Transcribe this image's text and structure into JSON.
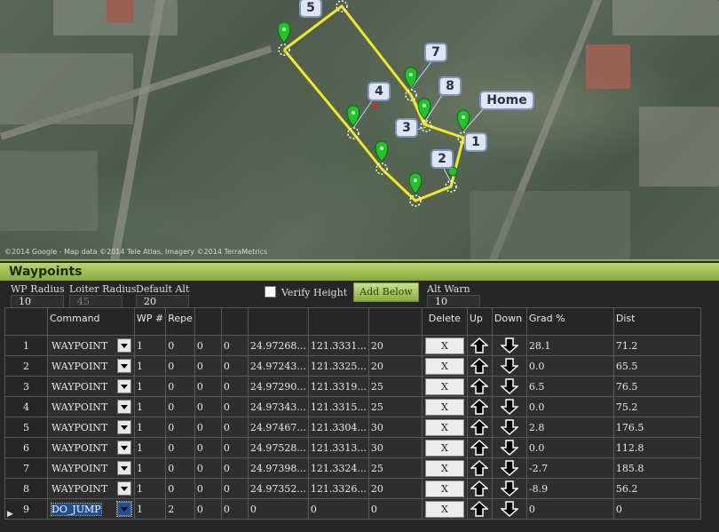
{
  "map": {
    "copyright": "©2014 Google - Map data ©2014 Tele Atlas, Imagery ©2014 TerraMetrics",
    "labels": [
      "5",
      "7",
      "4",
      "8",
      "Home",
      "3",
      "1",
      "2"
    ]
  },
  "panel": {
    "title": "Waypoints",
    "wp_radius_label": "WP Radius",
    "wp_radius_value": "10",
    "loiter_radius_label": "Loiter Radius",
    "loiter_radius_value": "45",
    "default_alt_label": "Default Alt",
    "default_alt_value": "20",
    "verify_height_label": "Verify Height",
    "add_below_label": "Add Below",
    "alt_warn_label": "Alt Warn",
    "alt_warn_value": "10"
  },
  "grid": {
    "headers": [
      "Command",
      "WP #",
      "Repe",
      "",
      "",
      "",
      "",
      "",
      "Delete",
      "Up",
      "Down",
      "Grad %",
      "Dist"
    ],
    "rows": [
      {
        "n": "1",
        "cmd": "WAYPOINT",
        "wp": "1",
        "p2": "0",
        "p3": "0",
        "p4": "0",
        "lat": "24.97268...",
        "lng": "121.3331...",
        "alt": "20",
        "del": "X",
        "grad": "28.1",
        "dist": "71.2"
      },
      {
        "n": "2",
        "cmd": "WAYPOINT",
        "wp": "1",
        "p2": "0",
        "p3": "0",
        "p4": "0",
        "lat": "24.97243...",
        "lng": "121.3325...",
        "alt": "20",
        "del": "X",
        "grad": "0.0",
        "dist": "65.5"
      },
      {
        "n": "3",
        "cmd": "WAYPOINT",
        "wp": "1",
        "p2": "0",
        "p3": "0",
        "p4": "0",
        "lat": "24.97290...",
        "lng": "121.3319...",
        "alt": "25",
        "del": "X",
        "grad": "6.5",
        "dist": "76.5"
      },
      {
        "n": "4",
        "cmd": "WAYPOINT",
        "wp": "1",
        "p2": "0",
        "p3": "0",
        "p4": "0",
        "lat": "24.97343...",
        "lng": "121.3315...",
        "alt": "25",
        "del": "X",
        "grad": "0.0",
        "dist": "75.2"
      },
      {
        "n": "5",
        "cmd": "WAYPOINT",
        "wp": "1",
        "p2": "0",
        "p3": "0",
        "p4": "0",
        "lat": "24.97467...",
        "lng": "121.3304...",
        "alt": "30",
        "del": "X",
        "grad": "2.8",
        "dist": "176.5"
      },
      {
        "n": "6",
        "cmd": "WAYPOINT",
        "wp": "1",
        "p2": "0",
        "p3": "0",
        "p4": "0",
        "lat": "24.97528...",
        "lng": "121.3313...",
        "alt": "30",
        "del": "X",
        "grad": "0.0",
        "dist": "112.8"
      },
      {
        "n": "7",
        "cmd": "WAYPOINT",
        "wp": "1",
        "p2": "0",
        "p3": "0",
        "p4": "0",
        "lat": "24.97398...",
        "lng": "121.3324...",
        "alt": "25",
        "del": "X",
        "grad": "-2.7",
        "dist": "185.8"
      },
      {
        "n": "8",
        "cmd": "WAYPOINT",
        "wp": "1",
        "p2": "0",
        "p3": "0",
        "p4": "0",
        "lat": "24.97352...",
        "lng": "121.3326...",
        "alt": "20",
        "del": "X",
        "grad": "-8.9",
        "dist": "56.2"
      },
      {
        "n": "9",
        "cmd": "DO_JUMP",
        "wp": "1",
        "p2": "2",
        "p3": "0",
        "p4": "0",
        "lat": "0",
        "lng": "0",
        "alt": "0",
        "del": "X",
        "grad": "0",
        "dist": "0"
      }
    ]
  },
  "colors": {
    "route": "#f2ea1f",
    "marker": "#22c22a",
    "accent": "#8ab43b"
  },
  "icons": [
    "dropdown-arrow-icon",
    "up-arrow-icon",
    "down-arrow-icon",
    "map-marker-icon",
    "row-pointer-icon"
  ]
}
